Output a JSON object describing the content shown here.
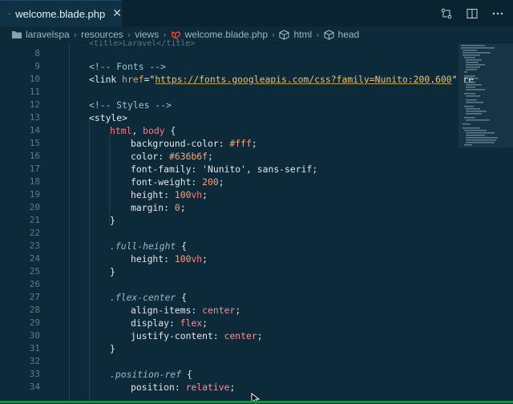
{
  "tab": {
    "label": "welcome.blade.php",
    "close": "✕"
  },
  "icons": [
    "laravel-icon",
    "close-icon",
    "compare-changes-icon",
    "split-editor-icon",
    "more-icon",
    "folder-icon",
    "html-element-icon",
    "chevron-right-icon"
  ],
  "breadcrumb": {
    "items": [
      "laravelspa",
      "resources",
      "views",
      "welcome.blade.php",
      "html",
      "head"
    ]
  },
  "colors": {
    "background": "#0c2a3a",
    "tab_active": "#0e3244",
    "accent": "#1e8a4a"
  },
  "lines": [
    {
      "n": "8"
    },
    {
      "n": "9"
    },
    {
      "n": "10"
    },
    {
      "n": "11"
    },
    {
      "n": "12"
    },
    {
      "n": "13"
    },
    {
      "n": "14"
    },
    {
      "n": "15"
    },
    {
      "n": "16"
    },
    {
      "n": "17"
    },
    {
      "n": "18"
    },
    {
      "n": "19"
    },
    {
      "n": "20"
    },
    {
      "n": "21"
    },
    {
      "n": "22"
    },
    {
      "n": "23"
    },
    {
      "n": "24"
    },
    {
      "n": "25"
    },
    {
      "n": "26"
    },
    {
      "n": "27"
    },
    {
      "n": "28"
    },
    {
      "n": "29"
    },
    {
      "n": "30"
    },
    {
      "n": "31"
    },
    {
      "n": "32"
    },
    {
      "n": "33"
    },
    {
      "n": "34"
    }
  ],
  "code": {
    "l8_partial": "<title>Laravel</title>",
    "l9": "<!-- Fonts -->",
    "l10_tag": "<link ",
    "l10_attr": "href",
    "l10_eq": "=\"",
    "l10_url": "https://fonts.googleapis.com/css?family=Nunito:200,600",
    "l10_tail": "\" re",
    "l12": "<!-- Styles -->",
    "l13": "<style>",
    "l14_sel1": "html",
    "l14_comma": ", ",
    "l14_sel2": "body",
    "l14_brace": " {",
    "l15_prop": "background-color: ",
    "l15_val": "#fff",
    "l16_prop": "color: ",
    "l16_val": "#636b6f",
    "l17_prop": "font-family: ",
    "l17_val": "'Nunito'",
    "l17_rest": ", sans-serif;",
    "l18_prop": "font-weight: ",
    "l18_val": "200",
    "l19_prop": "height: ",
    "l19_num": "100",
    "l19_unit": "vh",
    "l20_prop": "margin: ",
    "l20_val": "0",
    "close_brace": "}",
    "l23_sel": ".full-height",
    "l24_prop": "height: ",
    "l24_num": "100",
    "l24_unit": "vh",
    "l27_sel": ".flex-center",
    "l28_prop": "align-items: ",
    "l28_val": "center",
    "l29_prop": "display: ",
    "l29_val": "flex",
    "l30_prop": "justify-content: ",
    "l30_val": "center",
    "l33_sel": ".position-ref",
    "l34_prop": "position: ",
    "l34_val": "relative",
    "semi": ";",
    "open_brace": " {"
  }
}
